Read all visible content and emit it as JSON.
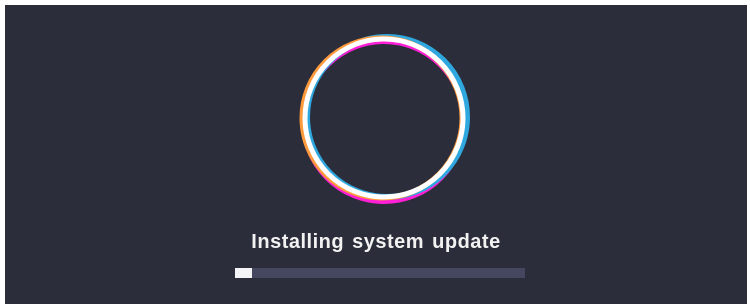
{
  "status": {
    "message": "Installing system update"
  },
  "progress": {
    "fraction": 0.06
  },
  "spinner": {
    "icon": "update-ring-icon",
    "colors": [
      "#ffffff",
      "#ff1fd6",
      "#2fa8e0",
      "#ff9a3c",
      "#8a5cff"
    ]
  },
  "theme": {
    "background": "#2b2d3a",
    "track": "#45465f",
    "fill": "#f4f4f6"
  }
}
